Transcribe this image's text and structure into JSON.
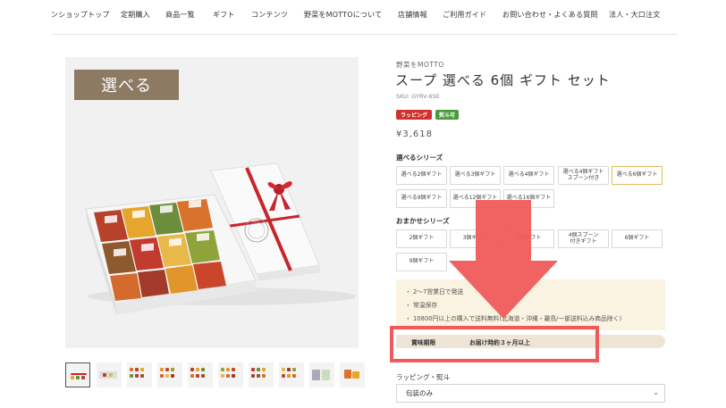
{
  "nav": {
    "items": [
      "ンショップトップ",
      "定期購入",
      "商品一覧",
      "ギフト",
      "コンテンツ",
      "野菜をMOTTOについて",
      "店舗情報",
      "ご利用ガイド",
      "お問い合わせ・よくある質問",
      "法人・大口注文"
    ]
  },
  "product": {
    "image_badge": "選べる",
    "brand": "野菜をMOTTO",
    "title": "スープ 選べる 6個 ギフト セット",
    "sku": "SKU: GYRV-6SE",
    "badges": [
      "ラッピング",
      "熨斗可"
    ],
    "price": "¥3,618"
  },
  "choose_series": {
    "label": "選べるシリーズ",
    "options": [
      "選べる2個ギフト",
      "選べる3個ギフト",
      "選べる4個ギフト",
      "選べる4個ギフト\nスプーン付き",
      "選べる6個ギフト",
      "選べる9個ギフト",
      "選べる12個ギフト",
      "選べる16個ギフト"
    ],
    "selected": "選べる6個ギフト"
  },
  "omakase_series": {
    "label": "おまかせシリーズ",
    "options": [
      "2個ギフト",
      "3個ギフト",
      "4個ギフト",
      "4個スプーン\n付きギフト",
      "6個ギフト",
      "9個ギフト"
    ]
  },
  "info": {
    "lines": [
      "2〜7営業日で発送",
      "常温保存",
      "10800円以上の購入で送料無料(北海道・沖縄・離島/一部送料込み商品除く)"
    ],
    "expiry_label": "賞味期限",
    "expiry_value": "お届け時約３ヶ月以上"
  },
  "wrapping": {
    "label": "ラッピング・熨斗",
    "selected": "包装のみ"
  },
  "colors": {
    "image_badge_bg": "#8c7a63",
    "badge_wrap": "#d0312d",
    "badge_noshi": "#4a9a3c",
    "overlay_red": "#f05a5b",
    "info_bg": "#fbf3e2",
    "selected_border": "#e2b95b"
  },
  "icons": {
    "select_arrow": "chevron-down-icon"
  }
}
